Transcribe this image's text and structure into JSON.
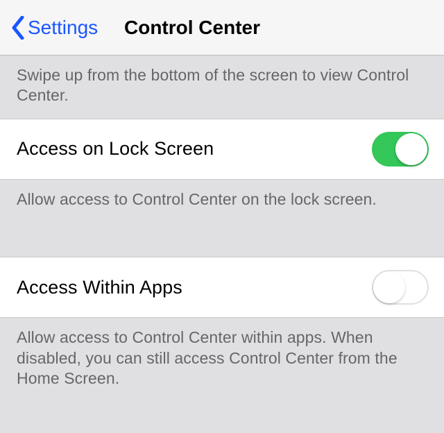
{
  "nav": {
    "back_label": "Settings",
    "title": "Control Center"
  },
  "intro_text": "Swipe up from the bottom of the screen to view Control Center.",
  "rows": [
    {
      "label": "Access on Lock Screen",
      "description": "Allow access to Control Center on the lock screen.",
      "value": true
    },
    {
      "label": "Access Within Apps",
      "description": "Allow access to Control Center within apps. When disabled, you can still access Control Center from the Home Screen.",
      "value": false
    }
  ]
}
